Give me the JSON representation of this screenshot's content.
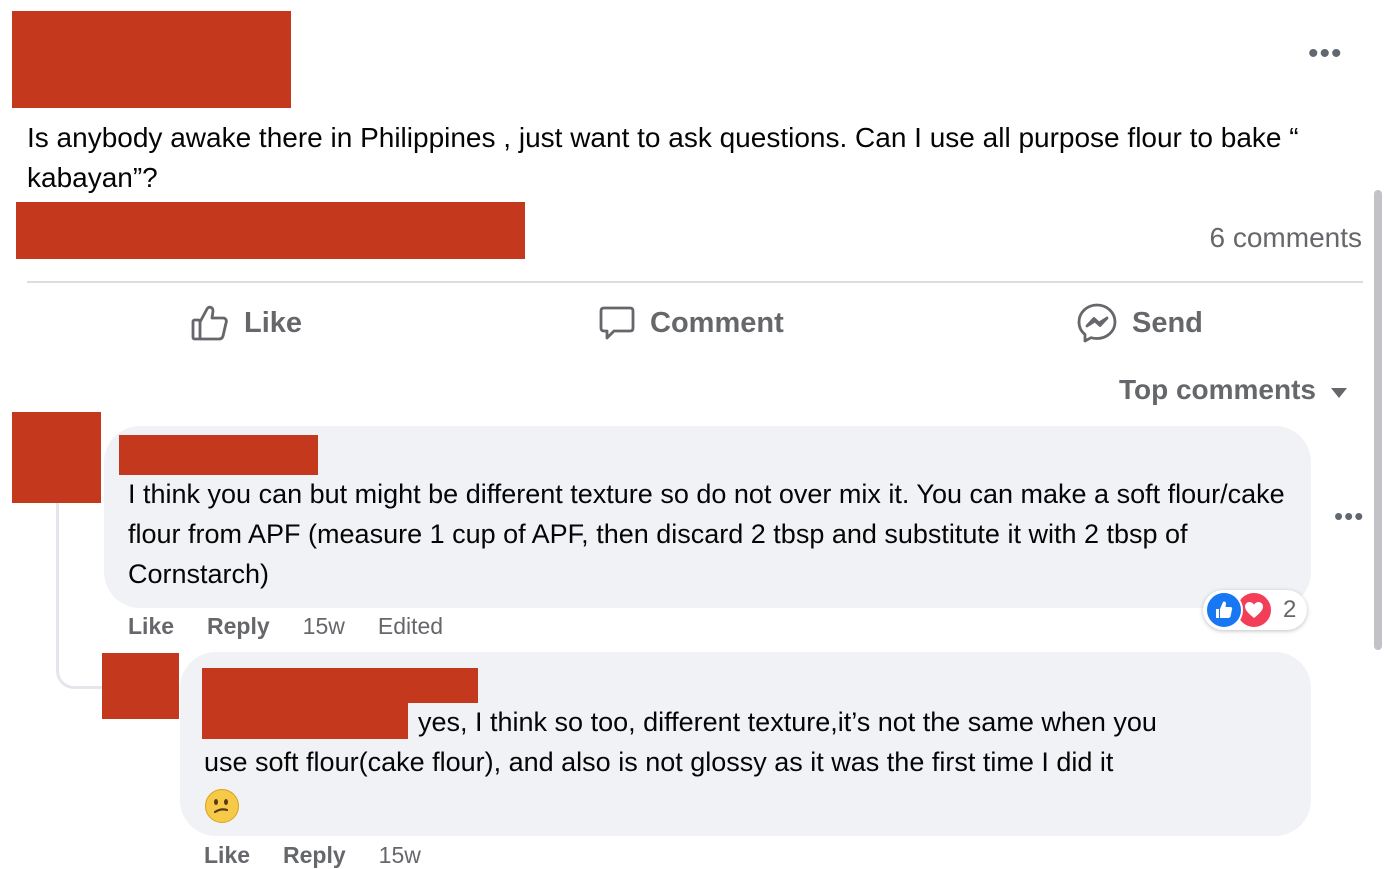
{
  "post": {
    "more_label": "•••",
    "text": "Is anybody awake there in Philippines , just want to ask questions. Can I use all purpose flour to bake “ kabayan”?",
    "comments_count": "6 comments"
  },
  "actions": {
    "like": "Like",
    "comment": "Comment",
    "send": "Send"
  },
  "sort": {
    "label": "Top comments"
  },
  "comments": [
    {
      "text": "I think you can but might be different texture so do not over mix it. You can make a soft flour/cake flour from APF (measure 1 cup of APF, then discard 2 tbsp and substitute it with 2 tbsp of Cornstarch)",
      "like": "Like",
      "reply": "Reply",
      "time": "15w",
      "edited": "Edited",
      "reaction_count": "2",
      "reactions": [
        "like",
        "love"
      ],
      "more_label": "•••"
    },
    {
      "text_first": "yes, I think so too, different texture,it’s not the same when you",
      "text_rest": "use soft flour(cake flour), and also is not glossy as it was the first time I did it",
      "emoji": "confused-face",
      "like": "Like",
      "reply": "Reply",
      "time": "15w"
    }
  ],
  "colors": {
    "redaction": "#c4391d",
    "bubble": "#f0f2f5",
    "muted_text": "#65676b",
    "like_blue": "#1877f2",
    "love_red": "#f33e58"
  }
}
